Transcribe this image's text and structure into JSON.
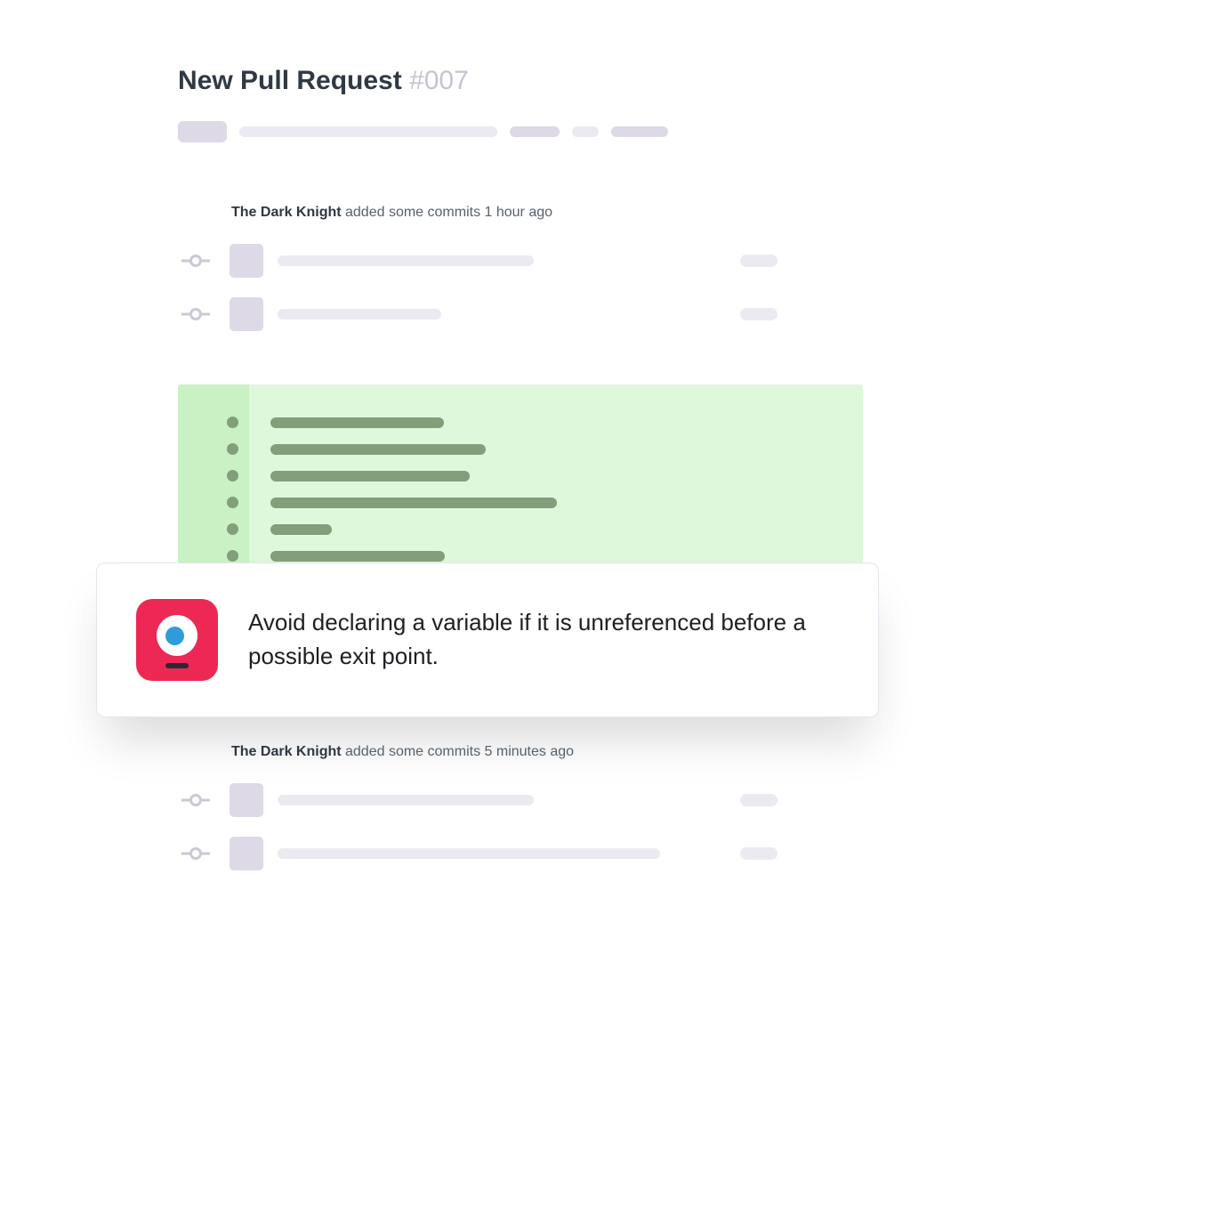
{
  "title": {
    "prefix": "New Pull Request ",
    "number": "#007"
  },
  "activities": [
    {
      "author": "The Dark Knight",
      "action": " added some commits ",
      "time": "1 hour ago",
      "commits": [
        {
          "lineWidth": 288
        },
        {
          "lineWidth": 184
        }
      ]
    },
    {
      "author": "The Dark Knight",
      "action": " added some commits ",
      "time": "5 minutes ago",
      "commits": [
        {
          "lineWidth": 288
        },
        {
          "lineWidth": 430
        }
      ]
    }
  ],
  "diff_lines": [
    195,
    242,
    224,
    322,
    69,
    196
  ],
  "suggestion": {
    "text": "Avoid declaring a variable if it is unreferenced before a possible exit point."
  },
  "colors": {
    "accent": "#ed2855",
    "diff_bg": "#ddf8da",
    "diff_gutter": "#c9f1c4",
    "diff_bar": "#829e7b"
  }
}
